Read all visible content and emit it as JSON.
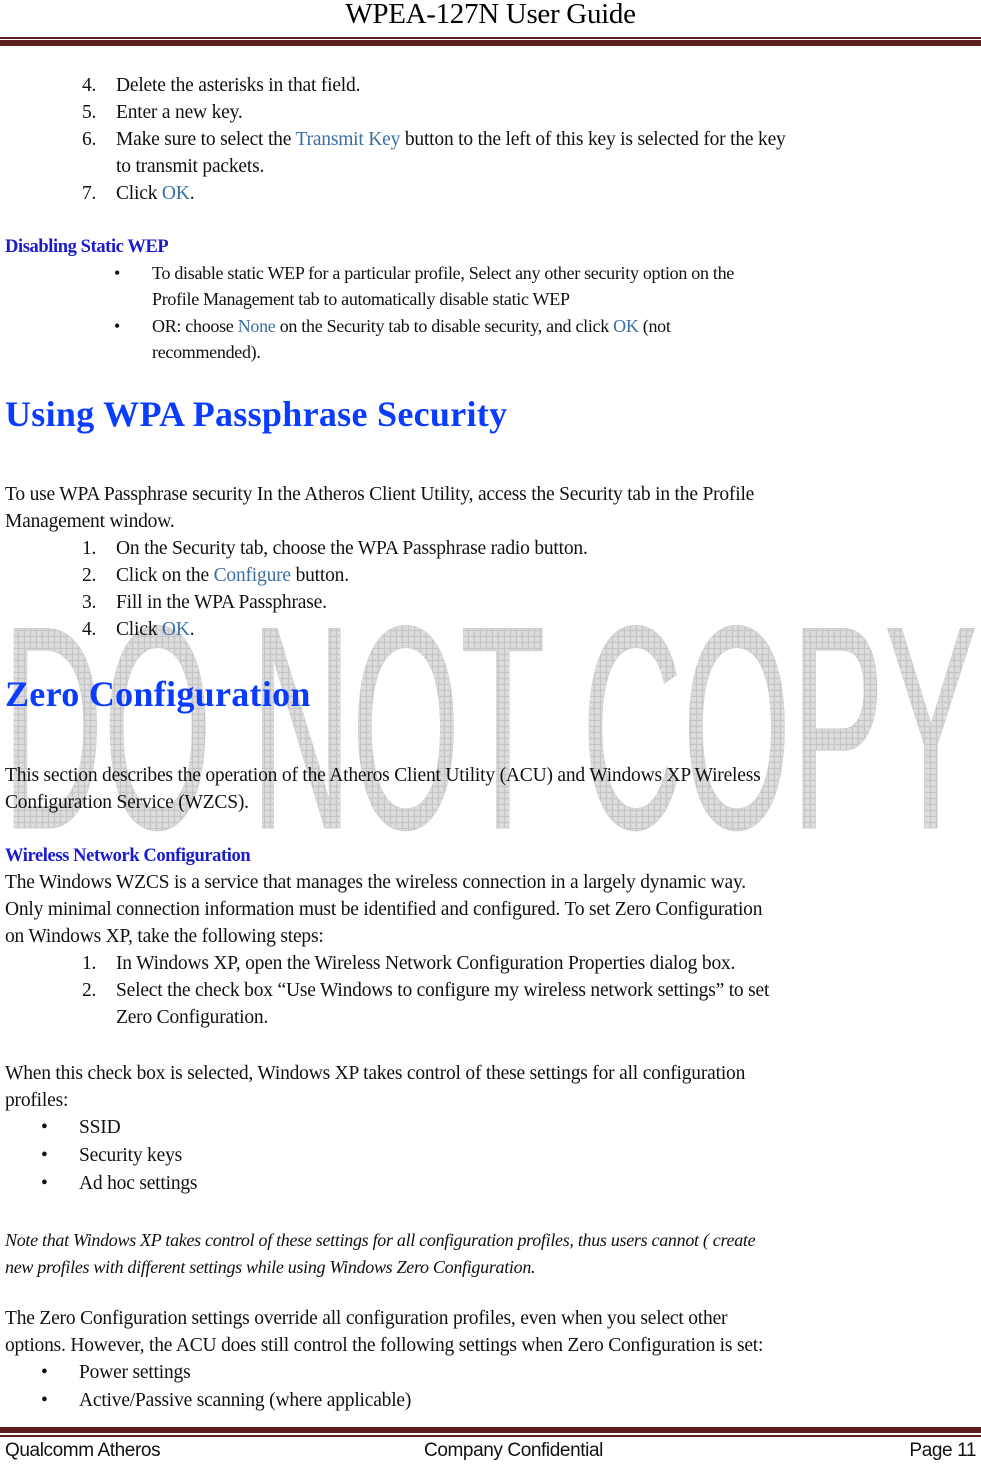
{
  "header": {
    "title": "WPEA-127N User Guide"
  },
  "colors": {
    "rule": "#5e1f1f",
    "link": "#3a6ea5",
    "heading_main": "#0a3cff",
    "heading_sub": "#1a1ad0",
    "watermark": "#d4d4d4"
  },
  "watermark": {
    "text": "DO NOT COPY"
  },
  "steps_top": [
    {
      "num": "4.",
      "text": "Delete the asterisks in that field."
    },
    {
      "num": "5.",
      "text": "Enter a new key."
    },
    {
      "num": "6.",
      "pre": "Make sure to select the ",
      "link": "Transmit Key",
      "post": " button to the left of this key is selected for the key",
      "cont": "to transmit packets."
    },
    {
      "num": "7.",
      "pre": "Click ",
      "link": "OK",
      "post": "."
    }
  ],
  "disabling_wep": {
    "heading": "Disabling Static WEP",
    "bullets": [
      {
        "line1": "To disable static WEP for a particular profile, Select any other security option on the",
        "line2": "Profile Management tab to automatically disable static WEP"
      },
      {
        "pre": "OR: choose ",
        "link1": "None",
        "mid": " on the Security tab to disable security, and click ",
        "link2": "OK",
        "post": " (not",
        "line2": "recommended)."
      }
    ]
  },
  "wpa_section": {
    "heading": "Using WPA Passphrase Security",
    "intro_line1": "To use WPA Passphrase security In the Atheros Client Utility, access the Security tab in the Profile",
    "intro_line2": "Management window.",
    "steps": [
      {
        "num": "1.",
        "text": "On the Security tab, choose the WPA Passphrase radio button."
      },
      {
        "num": "2.",
        "pre": "Click on the ",
        "link": "Configure",
        "post": " button."
      },
      {
        "num": "3.",
        "text": "Fill in the WPA Passphrase."
      },
      {
        "num": "4.",
        "pre": "Click ",
        "link": "OK",
        "post": "."
      }
    ]
  },
  "zero_config": {
    "heading": "Zero Configuration",
    "intro_line1": "This section describes the operation of the Atheros Client Utility (ACU) and Windows XP Wireless",
    "intro_line2": "Configuration Service (WZCS).",
    "subheading": "Wireless Network Configuration",
    "para_line1": "The Windows WZCS is a service that manages the wireless connection in a largely dynamic way.",
    "para_line2": "Only minimal connection information must be identified and configured. To set Zero Configuration",
    "para_line3": "on Windows XP, take the following steps:",
    "steps": [
      {
        "num": "1.",
        "text": "In Windows XP, open the Wireless Network Configuration Properties dialog box."
      },
      {
        "num": "2.",
        "text": "Select the check box “Use Windows to configure my wireless network settings” to set",
        "cont": "Zero Configuration."
      }
    ],
    "checkbox_para_line1": "When this check box is selected, Windows XP takes control of these settings for all configuration",
    "checkbox_para_line2": "profiles:",
    "controlled_settings": [
      "SSID",
      "Security keys",
      "Ad hoc settings"
    ],
    "note_line1": "Note that Windows XP takes control of these settings for all configuration profiles, thus users cannot ( create",
    "note_line2": "new profiles with different settings while using Windows Zero Configuration.",
    "override_line1": "The Zero Configuration settings override all configuration profiles, even when you select other",
    "override_line2": "options. However, the ACU does still control the following settings when Zero Configuration is set:",
    "acu_settings": [
      "Power settings",
      "Active/Passive scanning (where applicable)"
    ]
  },
  "footer": {
    "left": "Qualcomm Atheros",
    "center": "Company Confidential",
    "right": "Page 11"
  }
}
